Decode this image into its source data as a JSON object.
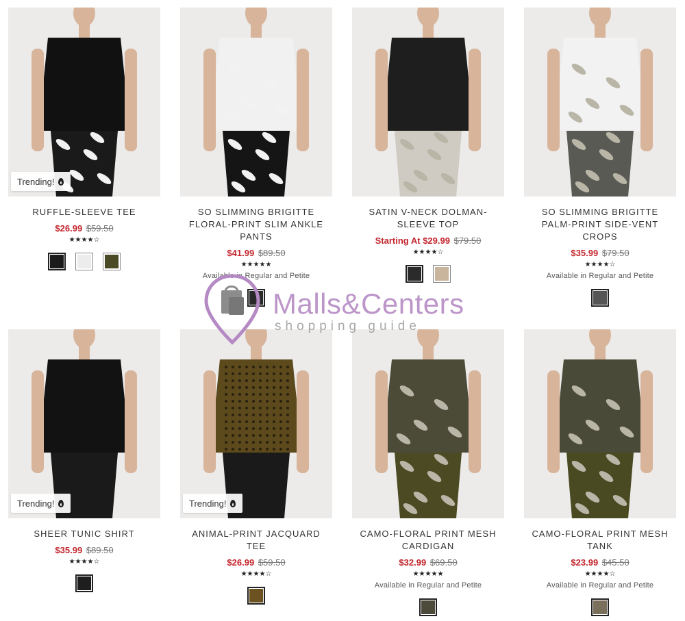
{
  "watermark": {
    "title": "Malls&Centers",
    "subtitle": "shopping guide"
  },
  "trending_label": "Trending!",
  "products": [
    {
      "name": "RUFFLE-SLEEVE TEE",
      "sale": "$26.99",
      "original": "$59.50",
      "rating": "★★★★☆",
      "trending": true,
      "availability": "",
      "swatches": [
        "#1b1b1b",
        "#ececec",
        "#4a4a25"
      ],
      "photo": {
        "top": "#111111",
        "bottom": "#1a1a1a",
        "pattern": "floral"
      }
    },
    {
      "name": "SO SLIMMING BRIGITTE FLORAL-PRINT SLIM ANKLE PANTS",
      "sale": "$41.99",
      "original": "$89.50",
      "rating": "★★★★★",
      "trending": false,
      "availability": "Available in Regular and Petite",
      "swatches": [
        "#2a2a2a"
      ],
      "photo": {
        "top": "#f1f1f1",
        "bottom": "#151515",
        "pattern": "floral"
      }
    },
    {
      "name": "SATIN V-NECK DOLMAN-SLEEVE TOP",
      "sale": "Starting At $29.99",
      "original": "$79.50",
      "rating": "★★★★☆",
      "trending": false,
      "availability": "",
      "swatches": [
        "#2b2b2b",
        "#c9b49c"
      ],
      "photo": {
        "top": "#1e1e1e",
        "bottom": "#cfcbc2",
        "pattern": "leaf"
      }
    },
    {
      "name": "SO SLIMMING BRIGITTE PALM-PRINT SIDE-VENT CROPS",
      "sale": "$35.99",
      "original": "$79.50",
      "rating": "★★★★☆",
      "trending": false,
      "availability": "Available in Regular and Petite",
      "swatches": [
        "#555555"
      ],
      "photo": {
        "top": "#f2f2f2",
        "bottom": "#5a5a55",
        "pattern": "leaf"
      }
    },
    {
      "name": "SHEER TUNIC SHIRT",
      "sale": "$35.99",
      "original": "$89.50",
      "rating": "★★★★☆",
      "trending": true,
      "availability": "",
      "swatches": [
        "#1e1e1e"
      ],
      "photo": {
        "top": "#121212",
        "bottom": "#1a1a1a",
        "pattern": "none"
      }
    },
    {
      "name": "ANIMAL-PRINT JACQUARD TEE",
      "sale": "$26.99",
      "original": "$59.50",
      "rating": "★★★★☆",
      "trending": true,
      "availability": "",
      "swatches": [
        "#6b5220"
      ],
      "photo": {
        "top": "#5c4a1c",
        "bottom": "#1a1a1a",
        "pattern": "dots"
      }
    },
    {
      "name": "CAMO-FLORAL PRINT MESH CARDIGAN",
      "sale": "$32.99",
      "original": "$69.50",
      "rating": "★★★★★",
      "trending": false,
      "availability": "Available in Regular and Petite",
      "swatches": [
        "#4c4a3a"
      ],
      "photo": {
        "top": "#4b4b38",
        "bottom": "#4b4a22",
        "pattern": "leaf"
      }
    },
    {
      "name": "CAMO-FLORAL PRINT MESH TANK",
      "sale": "$23.99",
      "original": "$45.50",
      "rating": "★★★★☆",
      "trending": false,
      "availability": "Available in Regular and Petite",
      "swatches": [
        "#7a6f5a"
      ],
      "photo": {
        "top": "#4a4a38",
        "bottom": "#4a4a22",
        "pattern": "leaf"
      }
    }
  ]
}
